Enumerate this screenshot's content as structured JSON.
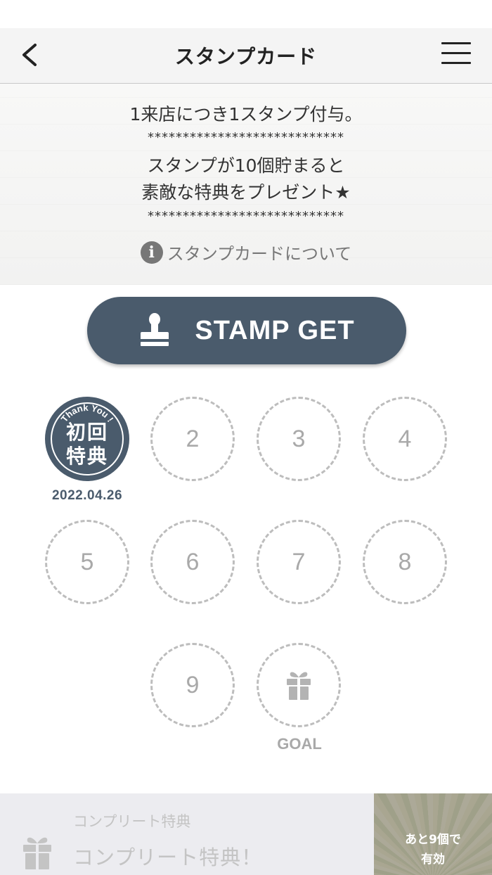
{
  "header": {
    "title": "スタンプカード"
  },
  "info": {
    "line1": "1来店につき1スタンプ付与。",
    "stars_top": "****************************",
    "line2a": "スタンプが10個貯まると",
    "line2b": "素敵な特典をプレゼント★",
    "stars_bottom": "****************************",
    "about_link": "スタンプカードについて"
  },
  "stamp_button": {
    "label": "STAMP GET"
  },
  "stamp_card": {
    "first_stamp": {
      "arc_text": "Thank You !",
      "kanji_top": "初回",
      "kanji_bottom": "特典",
      "date": "2022.04.26"
    },
    "slots": [
      "2",
      "3",
      "4",
      "5",
      "6",
      "7",
      "8",
      "9"
    ],
    "goal_label": "GOAL"
  },
  "footer": {
    "title": "コンプリート特典",
    "main": "コンプリート特典！",
    "badge_line1": "あと9個で",
    "badge_line2": "有効"
  },
  "colors": {
    "accent": "#4a5b6c",
    "dashed_slot": "#bdbdbd",
    "slot_number": "#a9a9a9"
  }
}
